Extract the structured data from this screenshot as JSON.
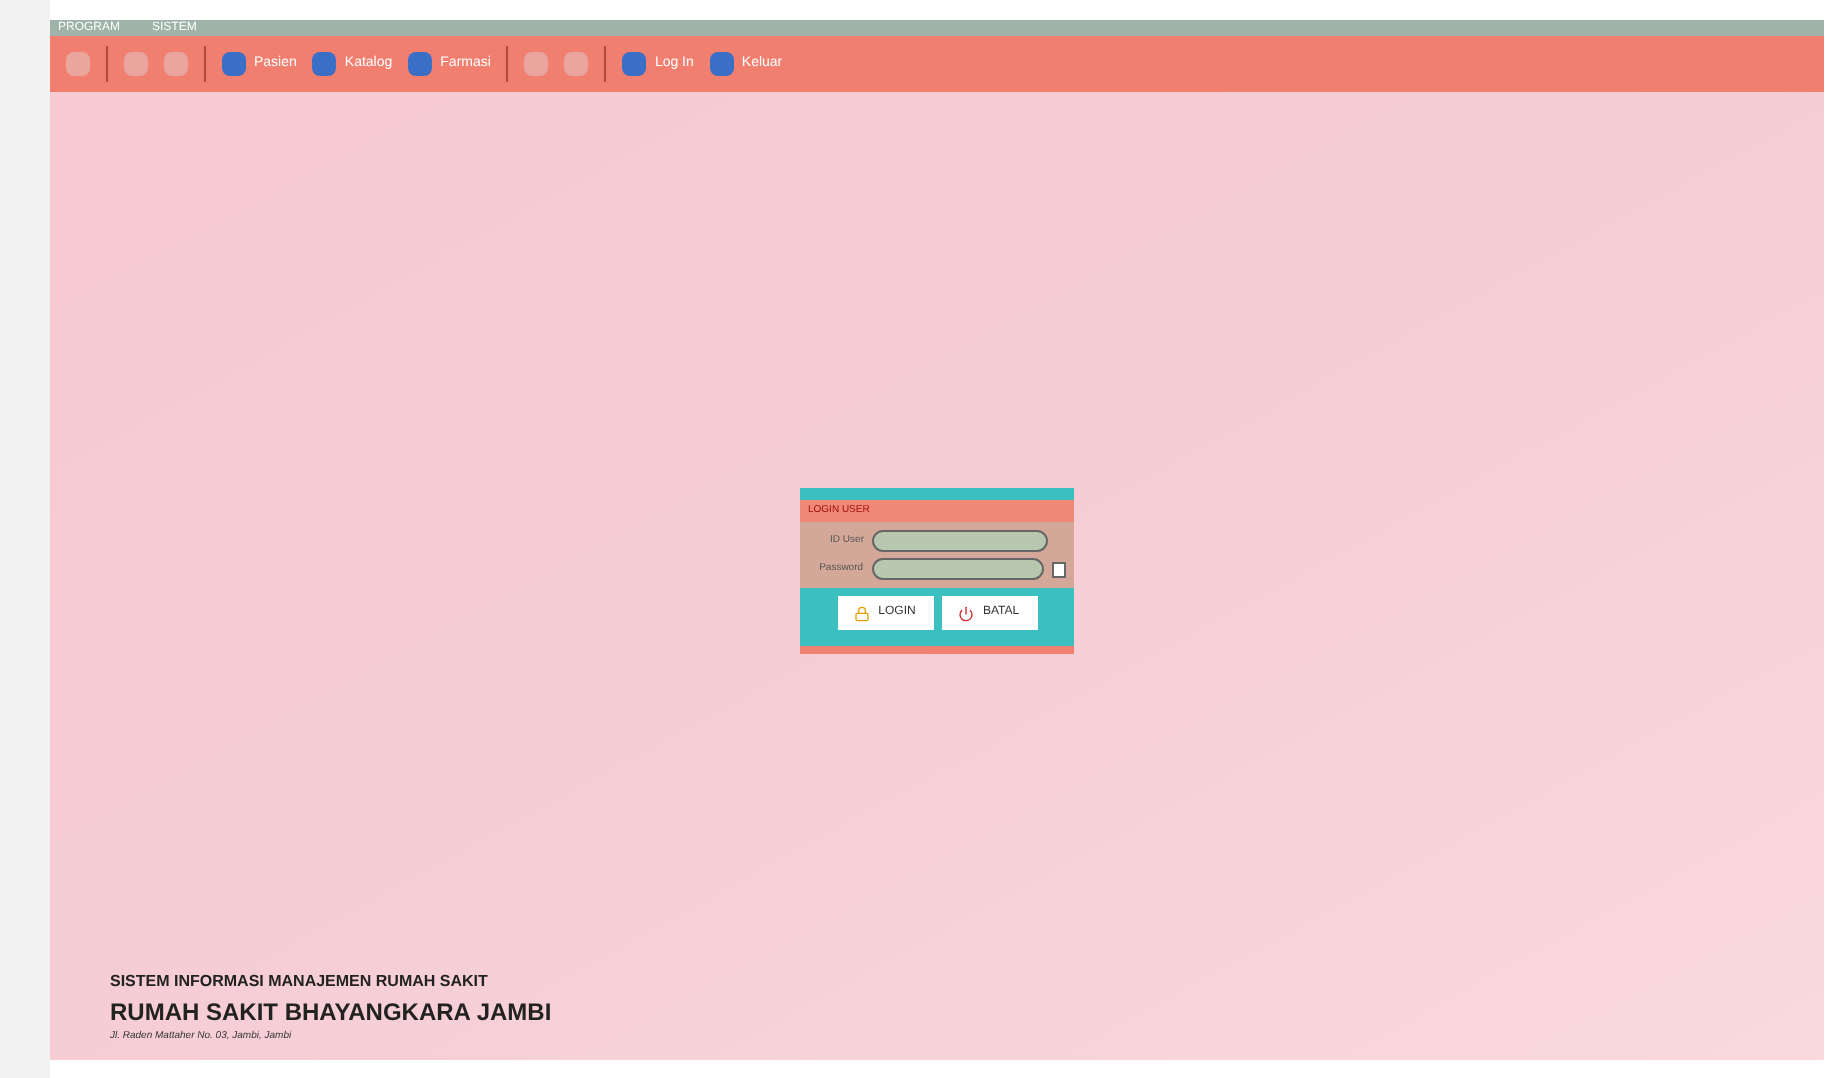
{
  "menu": [
    "PROGRAM",
    "SISTEM"
  ],
  "toolbar": [
    [
      {
        "disabled": true
      }
    ],
    [
      {
        "disabled": true
      },
      {
        "disabled": true
      }
    ],
    [
      {
        "label": "Pasien",
        "disabled": false
      },
      {
        "label": "Katalog",
        "disabled": false
      },
      {
        "label": "Farmasi",
        "disabled": false
      }
    ],
    [
      {
        "disabled": true
      },
      {
        "disabled": true
      }
    ],
    [
      {
        "label": "Log In",
        "disabled": false
      },
      {
        "label": "Keluar",
        "disabled": false
      }
    ]
  ],
  "login": {
    "title": "LOGIN USER",
    "fields": [
      {
        "label": "ID User"
      },
      {
        "label": "Password"
      }
    ],
    "buttons": [
      {
        "label": "LOGIN",
        "kind": "login"
      },
      {
        "label": "BATAL",
        "kind": "cancel"
      }
    ]
  },
  "footer": {
    "system": "SISTEM INFORMASI MANAJEMEN RUMAH SAKIT",
    "hospital": "RUMAH SAKIT BHAYANGKARA JAMBI",
    "address": "Jl. Raden Mattaher No. 03, Jambi, Jambi"
  }
}
